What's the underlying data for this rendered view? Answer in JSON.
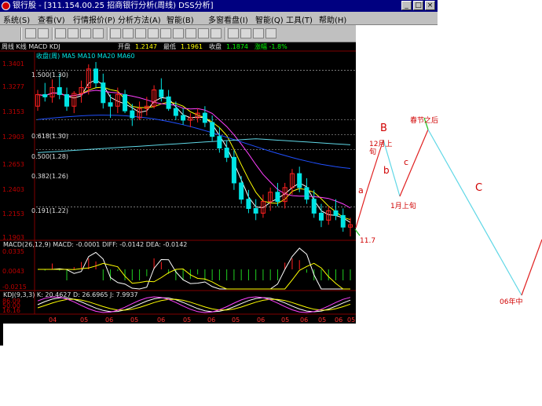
{
  "window": {
    "title": "银行股 - [311.154.00.25   招商银行分析(周线)   DSS分析]",
    "buttons": [
      "_",
      "□",
      "×"
    ]
  },
  "menu": [
    "系统(S)",
    "查看(V)",
    "行情报价(P)",
    "分析方法(A)",
    "智能(B)",
    "多窗看盘(I)",
    "智能(Q)",
    "工具(T)",
    "帮助(H)"
  ],
  "chart_header": {
    "period_label": "周线 K线 MACD KDJ",
    "info": [
      "开盘",
      "1.2147",
      "最低",
      "1.1961",
      "收盘",
      "1.1874",
      "涨幅 -1.8%"
    ],
    "ma_legend": "收盘(周)  MA5  MA10  MA20  MA60"
  },
  "chart_data": [
    {
      "type": "candlestick",
      "title": "",
      "y_ticks": [
        "1.3401",
        "1.3277",
        "1.3153",
        "1.2903",
        "1.2653",
        "1.2403",
        "1.2153",
        "1.1903"
      ],
      "candles": [
        [
          1.302,
          1.316,
          1.298,
          1.312
        ],
        [
          1.312,
          1.322,
          1.306,
          1.31
        ],
        [
          1.31,
          1.325,
          1.305,
          1.318
        ],
        [
          1.318,
          1.33,
          1.308,
          1.312
        ],
        [
          1.312,
          1.318,
          1.298,
          1.302
        ],
        [
          1.302,
          1.315,
          1.296,
          1.313
        ],
        [
          1.313,
          1.324,
          1.305,
          1.318
        ],
        [
          1.318,
          1.338,
          1.312,
          1.334
        ],
        [
          1.334,
          1.34,
          1.318,
          1.322
        ],
        [
          1.322,
          1.33,
          1.3,
          1.305
        ],
        [
          1.305,
          1.312,
          1.292,
          1.302
        ],
        [
          1.302,
          1.318,
          1.296,
          1.312
        ],
        [
          1.312,
          1.316,
          1.296,
          1.298
        ],
        [
          1.298,
          1.304,
          1.285,
          1.292
        ],
        [
          1.292,
          1.306,
          1.29,
          1.3
        ],
        [
          1.3,
          1.31,
          1.294,
          1.302
        ],
        [
          1.302,
          1.32,
          1.3,
          1.316
        ],
        [
          1.316,
          1.326,
          1.306,
          1.31
        ],
        [
          1.31,
          1.316,
          1.298,
          1.3
        ],
        [
          1.3,
          1.306,
          1.29,
          1.294
        ],
        [
          1.294,
          1.3,
          1.286,
          1.29
        ],
        [
          1.29,
          1.296,
          1.284,
          1.292
        ],
        [
          1.292,
          1.3,
          1.288,
          1.296
        ],
        [
          1.296,
          1.302,
          1.284,
          1.288
        ],
        [
          1.288,
          1.294,
          1.272,
          1.276
        ],
        [
          1.276,
          1.284,
          1.262,
          1.266
        ],
        [
          1.266,
          1.272,
          1.254,
          1.258
        ],
        [
          1.258,
          1.264,
          1.23,
          1.236
        ],
        [
          1.236,
          1.242,
          1.218,
          1.222
        ],
        [
          1.222,
          1.23,
          1.21,
          1.214
        ],
        [
          1.214,
          1.222,
          1.204,
          1.21
        ],
        [
          1.21,
          1.226,
          1.206,
          1.22
        ],
        [
          1.22,
          1.232,
          1.212,
          1.228
        ],
        [
          1.228,
          1.236,
          1.216,
          1.22
        ],
        [
          1.22,
          1.236,
          1.214,
          1.232
        ],
        [
          1.232,
          1.248,
          1.226,
          1.244
        ],
        [
          1.244,
          1.25,
          1.228,
          1.232
        ],
        [
          1.232,
          1.24,
          1.218,
          1.222
        ],
        [
          1.222,
          1.23,
          1.206,
          1.21
        ],
        [
          1.21,
          1.218,
          1.198,
          1.204
        ],
        [
          1.204,
          1.216,
          1.2,
          1.212
        ],
        [
          1.212,
          1.222,
          1.204,
          1.208
        ],
        [
          1.208,
          1.214,
          1.194,
          1.198
        ],
        [
          1.198,
          1.206,
          1.19,
          1.2
        ]
      ],
      "levels": [
        {
          "label": "1.500(1.30)",
          "value": 1.333
        },
        {
          "label": "0.618(1.30)",
          "value": 1.2905
        },
        {
          "label": "0.500(1.28)",
          "value": 1.2775
        },
        {
          "label": "0.382(1.26)",
          "value": 1.2645
        },
        {
          "label": "0.191(1.22)",
          "value": 1.2155
        }
      ]
    },
    {
      "type": "bar",
      "title": "MACD(26,12,9) MACD: -0.0001 DIFF: -0.0142 DEA: -0.0142",
      "y_ticks": [
        "0.0335",
        "0.0043",
        "-0.0215"
      ]
    },
    {
      "type": "line",
      "title": "KDJ(9,3,3) K: 20.4627 D: 26.6965 J: 7.9937",
      "y_ticks": [
        "86.09",
        "50.00",
        "16.16"
      ]
    }
  ],
  "x_axis_labels": [
    "04",
    "05",
    "06",
    "05",
    "06",
    "05",
    "06",
    "05",
    "06",
    "05",
    "06",
    "05",
    "06",
    "05"
  ],
  "annotations": {
    "B": "B",
    "peak12": "12月上",
    "peak12b": "旬",
    "b": "b",
    "c": "c",
    "jan": "1月上旬",
    "spring": "春节之后",
    "C": "C",
    "a": "a",
    "low117": "11.7",
    "end": "06年中"
  },
  "colors": {
    "chart_bg": "#000000",
    "bull": "#ff2020",
    "bear": "#00e5e5",
    "ma5": "#ffffff",
    "ma10": "#ffff00",
    "ma20": "#ff40ff",
    "ma60": "#2050ff",
    "wave_line": "#5fd7e6",
    "wave_line_red": "#e02020"
  }
}
